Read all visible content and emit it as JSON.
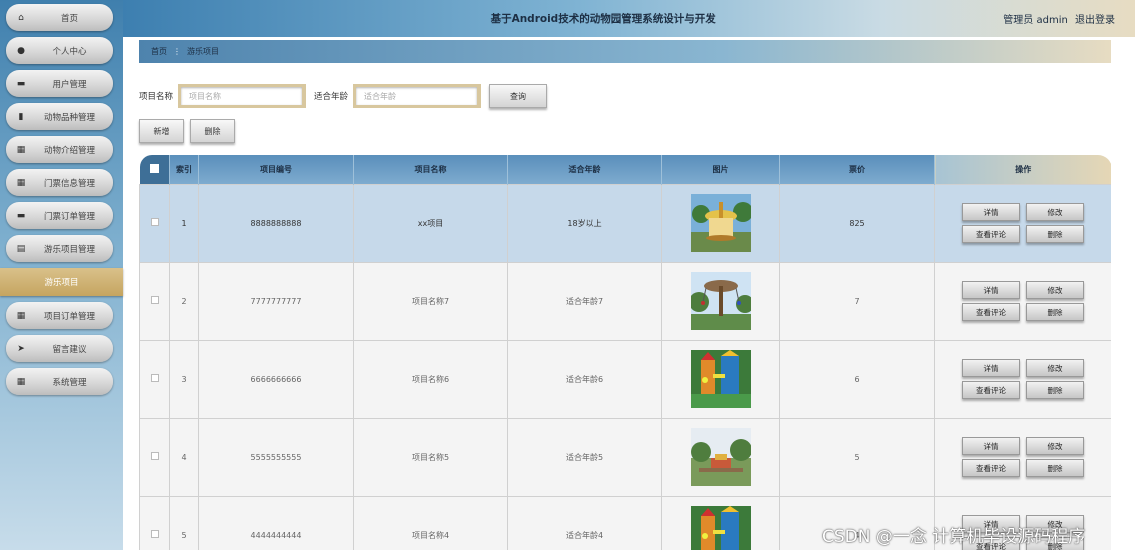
{
  "sidebar": {
    "items": [
      {
        "label": "首页",
        "icon": "home-icon",
        "glyph": "⌂",
        "active": false
      },
      {
        "label": "个人中心",
        "icon": "person-icon",
        "glyph": "●",
        "active": false
      },
      {
        "label": "用户管理",
        "icon": "users-icon",
        "glyph": "▬",
        "active": false
      },
      {
        "label": "动物品种管理",
        "icon": "bar-chart-icon",
        "glyph": "▮",
        "active": false
      },
      {
        "label": "动物介绍管理",
        "icon": "grid-icon",
        "glyph": "▦",
        "active": false
      },
      {
        "label": "门票信息管理",
        "icon": "grid-icon",
        "glyph": "▦",
        "active": false
      },
      {
        "label": "门票订单管理",
        "icon": "ticket-icon",
        "glyph": "▬",
        "active": false
      },
      {
        "label": "游乐项目管理",
        "icon": "document-icon",
        "glyph": "▤",
        "active": false
      },
      {
        "label": "游乐项目",
        "icon": "",
        "glyph": "",
        "active": true
      },
      {
        "label": "项目订单管理",
        "icon": "grid-icon",
        "glyph": "▦",
        "active": false
      },
      {
        "label": "留言建议",
        "icon": "send-icon",
        "glyph": "➤",
        "active": false
      },
      {
        "label": "系统管理",
        "icon": "grid-icon",
        "glyph": "▦",
        "active": false
      }
    ]
  },
  "header": {
    "title": "基于Android技术的动物园管理系统设计与开发",
    "user": "管理员 admin",
    "logout": "退出登录"
  },
  "breadcrumb": {
    "home": "首页",
    "separator": "⋮",
    "current": "游乐项目"
  },
  "search": {
    "name_label": "项目名称",
    "name_placeholder": "项目名称",
    "age_label": "适合年龄",
    "age_placeholder": "适合年龄",
    "button": "查询"
  },
  "actions": {
    "add": "新增",
    "delete": "删除"
  },
  "table": {
    "headers": {
      "index": "索引",
      "code": "项目编号",
      "name": "项目名称",
      "age": "适合年龄",
      "image": "图片",
      "price": "票价",
      "ops": "操作"
    },
    "op_labels": {
      "detail": "详情",
      "edit": "修改",
      "comments": "查看评论",
      "delete": "删除"
    },
    "rows": [
      {
        "index": "1",
        "code": "8888888888",
        "name": "xx项目",
        "age": "18岁以上",
        "price": "825",
        "image": "carousel"
      },
      {
        "index": "2",
        "code": "7777777777",
        "name": "项目名称7",
        "age": "适合年龄7",
        "price": "7",
        "image": "swing-ride"
      },
      {
        "index": "3",
        "code": "6666666666",
        "name": "项目名称6",
        "age": "适合年龄6",
        "price": "6",
        "image": "playground"
      },
      {
        "index": "4",
        "code": "5555555555",
        "name": "项目名称5",
        "age": "适合年龄5",
        "price": "5",
        "image": "park"
      },
      {
        "index": "5",
        "code": "4444444444",
        "name": "项目名称4",
        "age": "适合年龄4",
        "price": "4",
        "image": "playground"
      }
    ]
  },
  "watermark": "CSDN @一念 计算机毕设源码程序",
  "colors": {
    "accent_gold": "#c5a560",
    "header_blue": "#3d7fb0",
    "row_highlight": "#c6d9ea"
  }
}
